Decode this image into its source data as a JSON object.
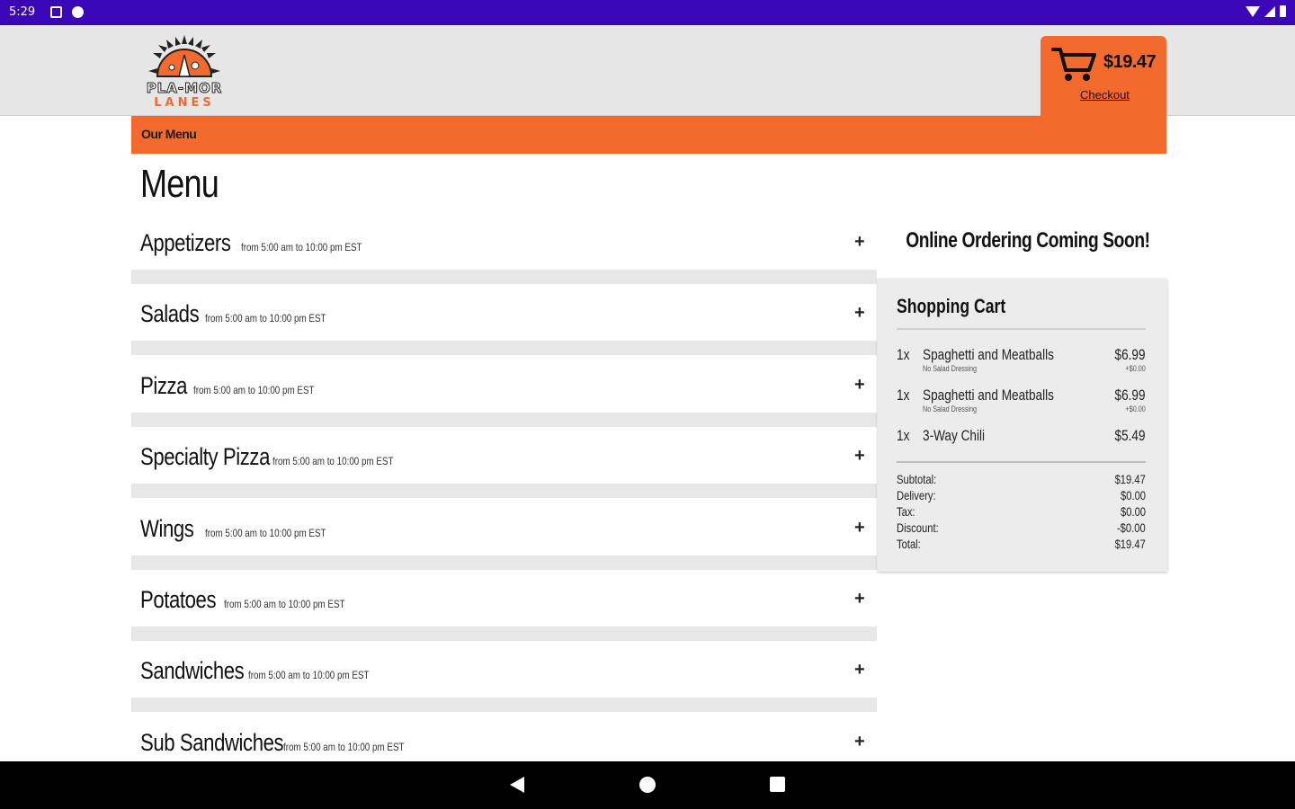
{
  "status_bar": {
    "time": "5:29"
  },
  "header": {
    "logo_text": "PLA-MOR",
    "logo_sub": "LANES",
    "nav_label": "Our Menu",
    "cart_total": "$19.47",
    "checkout_label": "Checkout",
    "accent_color": "#f26a2e"
  },
  "main": {
    "title": "Menu",
    "categories": [
      {
        "name": "Appetizers",
        "hours": "from 5:00 am to 10:00 pm EST"
      },
      {
        "name": "Salads",
        "hours": "from 5:00 am to 10:00 pm EST"
      },
      {
        "name": "Pizza",
        "hours": "from 5:00 am to 10:00 pm EST"
      },
      {
        "name": "Specialty Pizza",
        "hours": "from 5:00 am to 10:00 pm EST"
      },
      {
        "name": "Wings",
        "hours": "from 5:00 am to 10:00 pm EST"
      },
      {
        "name": "Potatoes",
        "hours": "from 5:00 am to 10:00 pm EST"
      },
      {
        "name": "Sandwiches",
        "hours": "from 5:00 am to 10:00 pm EST"
      },
      {
        "name": "Sub Sandwiches",
        "hours": "from 5:00 am to 10:00 pm EST"
      }
    ],
    "expand_symbol": "+"
  },
  "sidebar": {
    "notice": "Online Ordering Coming Soon!",
    "cart_title": "Shopping Cart",
    "items": [
      {
        "qty": "1x",
        "name": "Spaghetti and Meatballs",
        "price": "$6.99",
        "modifier": "No Salad Dressing",
        "modifier_price": "+$0.00"
      },
      {
        "qty": "1x",
        "name": "Spaghetti and Meatballs",
        "price": "$6.99",
        "modifier": "No Salad Dressing",
        "modifier_price": "+$0.00"
      },
      {
        "qty": "1x",
        "name": "3-Way Chili",
        "price": "$5.49",
        "modifier": "",
        "modifier_price": ""
      }
    ],
    "totals": [
      {
        "label": "Subtotal:",
        "value": "$19.47"
      },
      {
        "label": "Delivery:",
        "value": "$0.00"
      },
      {
        "label": "Tax:",
        "value": "$0.00"
      },
      {
        "label": "Discount:",
        "value": "-$0.00"
      },
      {
        "label": "Total:",
        "value": "$19.47"
      }
    ]
  }
}
